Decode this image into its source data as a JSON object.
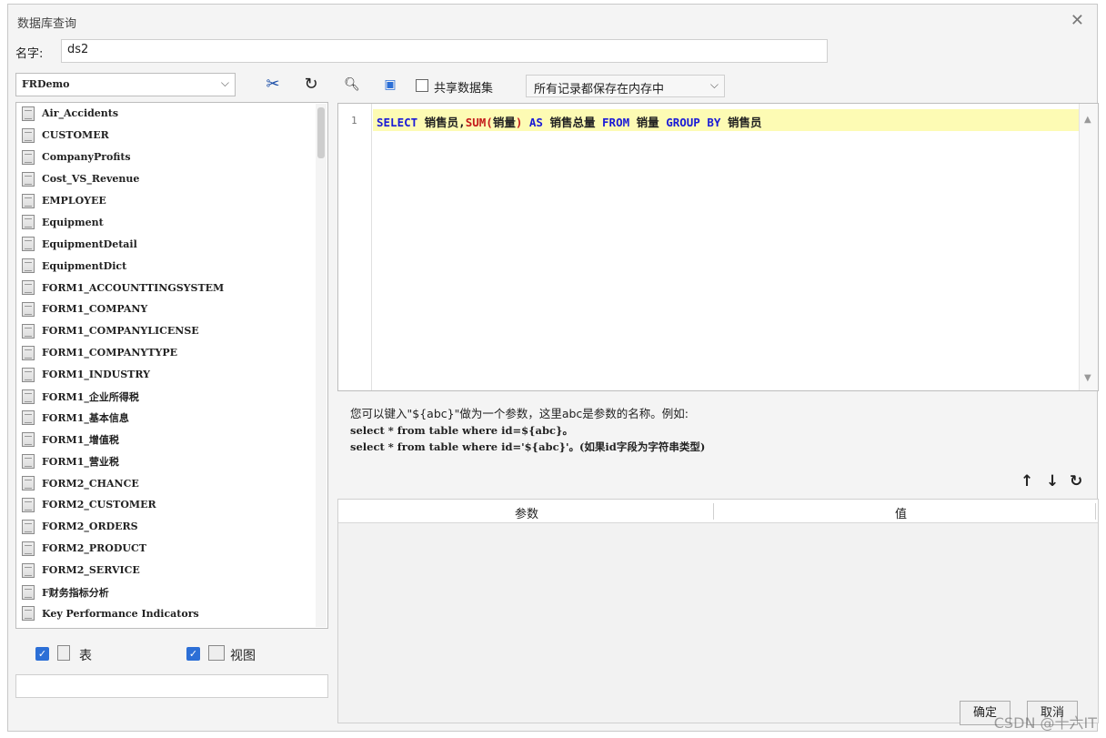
{
  "dialog": {
    "title": "数据库查询",
    "close_icon": "close-icon"
  },
  "name_field": {
    "label": "名字:",
    "value": "ds2"
  },
  "left": {
    "connection": "FRDemo",
    "tables": [
      "Air_Accidents",
      "CUSTOMER",
      "CompanyProfits",
      "Cost_VS_Revenue",
      "EMPLOYEE",
      "Equipment",
      "EquipmentDetail",
      "EquipmentDict",
      "FORM1_ACCOUNTTINGSYSTEM",
      "FORM1_COMPANY",
      "FORM1_COMPANYLICENSE",
      "FORM1_COMPANYTYPE",
      "FORM1_INDUSTRY",
      "FORM1_企业所得税",
      "FORM1_基本信息",
      "FORM1_增值税",
      "FORM1_营业税",
      "FORM2_CHANCE",
      "FORM2_CUSTOMER",
      "FORM2_ORDERS",
      "FORM2_PRODUCT",
      "FORM2_SERVICE",
      "F财务指标分析",
      "Key Performance Indicators"
    ],
    "filter_table_label": "表",
    "filter_view_label": "视图"
  },
  "right": {
    "share_label": "共享数据集",
    "memory_option": "所有记录都保存在内存中",
    "line_number": "1",
    "sql": {
      "t1": "SELECT",
      "t2": " 销售员,",
      "t3": "SUM(",
      "t4": "销量",
      "t5": ")",
      "t6": " AS ",
      "t7": "销售总量",
      "t8": " FROM ",
      "t9": "销量",
      "t10": " GROUP BY ",
      "t11": "销售员"
    },
    "hint_line1": "您可以键入\"${abc}\"做为一个参数，这里abc是参数的名称。例如:",
    "hint_line2": "select * from table where id=${abc}。",
    "hint_line3": "select * from table where id='${abc}'。(如果id字段为字符串类型)",
    "param_col_name": "参数",
    "param_col_value": "值"
  },
  "buttons": {
    "ok": "确定",
    "cancel": "取消"
  },
  "watermark": "CSDN @十六IT",
  "colors": {
    "keyword": "#1a1ad6",
    "function": "#c41a1a",
    "highlight_line": "#fdfbb4",
    "checkbox": "#2c6fd6"
  }
}
